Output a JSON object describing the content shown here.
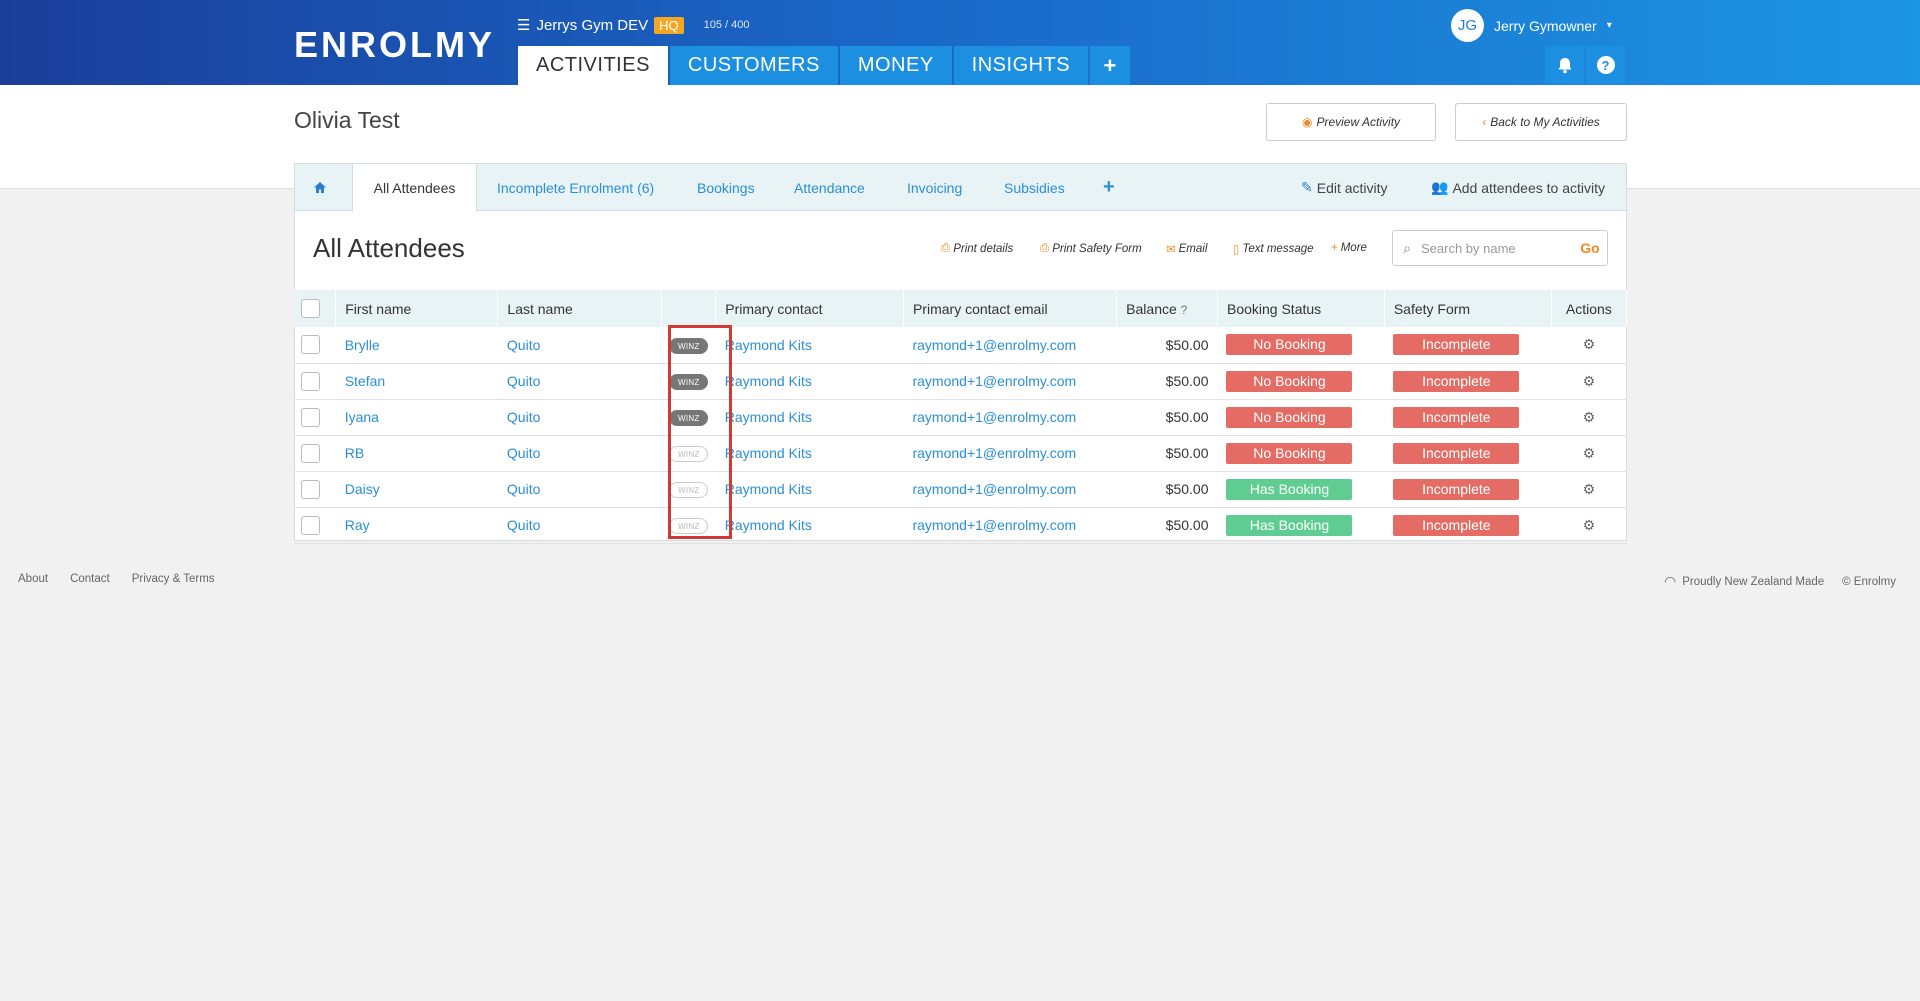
{
  "header": {
    "logo": "ENROLMY",
    "org_name": "Jerrys Gym DEV",
    "org_badge": "HQ",
    "usage": "105 / 400",
    "nav": [
      {
        "label": "ACTIVITIES",
        "active": true
      },
      {
        "label": "CUSTOMERS",
        "active": false
      },
      {
        "label": "MONEY",
        "active": false
      },
      {
        "label": "INSIGHTS",
        "active": false
      }
    ],
    "user_initials": "JG",
    "user_name": "Jerry Gymowner",
    "icons": [
      "menu-icon",
      "plus-icon",
      "bell-icon",
      "help-icon",
      "chevron-down-icon"
    ]
  },
  "page": {
    "title": "Olivia Test",
    "preview_label": "Preview Activity",
    "back_label": "Back to My Activities"
  },
  "tabs": {
    "items": [
      "All Attendees",
      "Incomplete Enrolment (6)",
      "Bookings",
      "Attendance",
      "Invoicing",
      "Subsidies"
    ],
    "active": "All Attendees",
    "edit_label": "Edit activity",
    "add_label": "Add attendees to activity"
  },
  "section": {
    "title": "All Attendees",
    "actions": [
      "Print details",
      "Print Safety Form",
      "Email",
      "Text message",
      "More"
    ],
    "search_placeholder": "Search by name",
    "search_go": "Go"
  },
  "table": {
    "columns": [
      "First name",
      "Last name",
      "",
      "Primary contact",
      "Primary contact email",
      "Balance",
      "Booking Status",
      "Safety Form",
      "Actions"
    ],
    "rows": [
      {
        "first": "Brylle",
        "last": "Quito",
        "winz": "WINZ",
        "winz_on": true,
        "contact": "Raymond Kits",
        "email": "raymond+1@enrolmy.com",
        "balance": "$50.00",
        "booking": "No Booking",
        "booking_color": "#e46c64",
        "safety": "Incomplete"
      },
      {
        "first": "Stefan",
        "last": "Quito",
        "winz": "WINZ",
        "winz_on": true,
        "contact": "Raymond Kits",
        "email": "raymond+1@enrolmy.com",
        "balance": "$50.00",
        "booking": "No Booking",
        "booking_color": "#e46c64",
        "safety": "Incomplete"
      },
      {
        "first": "Iyana",
        "last": "Quito",
        "winz": "WINZ",
        "winz_on": true,
        "contact": "Raymond Kits",
        "email": "raymond+1@enrolmy.com",
        "balance": "$50.00",
        "booking": "No Booking",
        "booking_color": "#e46c64",
        "safety": "Incomplete"
      },
      {
        "first": "RB",
        "last": "Quito",
        "winz": "WINZ",
        "winz_on": false,
        "contact": "Raymond Kits",
        "email": "raymond+1@enrolmy.com",
        "balance": "$50.00",
        "booking": "No Booking",
        "booking_color": "#e46c64",
        "safety": "Incomplete"
      },
      {
        "first": "Daisy",
        "last": "Quito",
        "winz": "WINZ",
        "winz_on": false,
        "contact": "Raymond Kits",
        "email": "raymond+1@enrolmy.com",
        "balance": "$50.00",
        "booking": "Has Booking",
        "booking_color": "#5fcd91",
        "safety": "Incomplete"
      },
      {
        "first": "Ray",
        "last": "Quito",
        "winz": "WINZ",
        "winz_on": false,
        "contact": "Raymond Kits",
        "email": "raymond+1@enrolmy.com",
        "balance": "$50.00",
        "booking": "Has Booking",
        "booking_color": "#5fcd91",
        "safety": "Incomplete"
      }
    ]
  },
  "footer": {
    "links": [
      "About",
      "Contact",
      "Privacy & Terms"
    ],
    "made": "Proudly New Zealand Made",
    "copyright": "© Enrolmy"
  },
  "colors": {
    "accent": "#1d8fe1",
    "link": "#2b8fd6",
    "orange": "#f08a24",
    "danger": "#e46c64",
    "success": "#5fcd91",
    "highlight": "#d23b33"
  }
}
